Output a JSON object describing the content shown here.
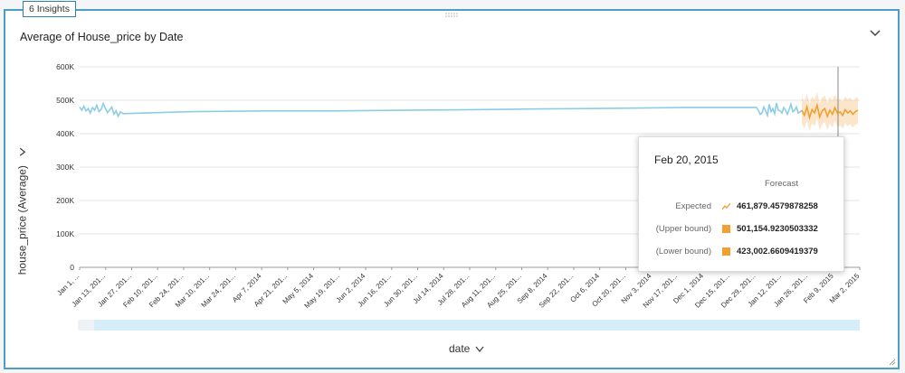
{
  "insights_tab": "6 Insights",
  "chart_title": "Average of House_price by Date",
  "y_axis_label": "house_price (Average)",
  "x_axis_label": "date",
  "colors": {
    "history": "#8ccde6",
    "forecast": "#f0a030",
    "panel_border": "#4d9ec7"
  },
  "icons": {
    "collapse": "chevron-down-icon",
    "axis_menu": "chevron-down-icon",
    "drag": "drag-handle-icon"
  },
  "tooltip": {
    "date": "Feb 20, 2015",
    "header": "Forecast",
    "rows": [
      {
        "label": "Expected",
        "icon": "trend-line-icon",
        "value": "461,879.4579878258"
      },
      {
        "label": "(Upper bound)",
        "icon": "square-icon",
        "value": "501,154.9230503332"
      },
      {
        "label": "(Lower bound)",
        "icon": "square-icon",
        "value": "423,002.6609419379"
      }
    ]
  },
  "chart_data": {
    "type": "line",
    "title": "Average of House_price by Date",
    "xlabel": "date",
    "ylabel": "house_price (Average)",
    "ylim": [
      0,
      600000
    ],
    "y_ticks": [
      "0",
      "100K",
      "200K",
      "300K",
      "400K",
      "500K",
      "600K"
    ],
    "x_ticks": [
      "Jan 1, ...",
      "Jan 13, 201...",
      "Jan 27, 201...",
      "Feb 10, 201...",
      "Feb 24, 201...",
      "Mar 10, 201...",
      "Mar 24, 201...",
      "Apr 7, 2014",
      "Apr 21, 201...",
      "May 5, 2014",
      "May 19, 201...",
      "Jun 2, 2014",
      "Jun 16, 201...",
      "Jun 30, 201...",
      "Jul 14, 2014",
      "Jul 28, 201...",
      "Aug 11, 201...",
      "Aug 25, 201...",
      "Sep 8, 2014",
      "Sep 22, 201...",
      "Oct 6, 2014",
      "Oct 20, 201...",
      "Nov 3, 2014",
      "Nov 17, 201...",
      "Dec 1, 2014",
      "Dec 15, 201...",
      "Dec 29, 201...",
      "Jan 12, 201...",
      "Jan 26, 201...",
      "Feb 9, 2015",
      "Mar 2, 2015"
    ],
    "grid": true,
    "series": [
      {
        "name": "",
        "values": [
          480000,
          470000,
          482000,
          468000,
          475000,
          462000,
          478000,
          470000,
          485000,
          466000,
          472000,
          490000,
          476000,
          463000,
          471000,
          480000,
          458000,
          468000,
          452000,
          465000,
          460000,
          466000,
          468000,
          468000,
          470000,
          472000,
          474000,
          476000,
          478000,
          478000,
          479000,
          478000,
          470000,
          458000,
          462000,
          480000,
          468000,
          455000,
          488000,
          466000,
          475000,
          460000,
          492000,
          470000,
          468000,
          462000,
          478000,
          470000,
          458000,
          472000,
          488000,
          466000,
          470000,
          480000,
          462000,
          465000,
          470000
        ]
      },
      {
        "name": "Forecast",
        "values": [
          470000,
          455000,
          480000,
          448000,
          472000,
          462000,
          485000,
          450000,
          468000,
          475000,
          452000,
          470000,
          458000,
          478000,
          460000,
          465000,
          455000,
          472000,
          462000,
          468000,
          458000,
          466000,
          470000
        ]
      }
    ]
  }
}
